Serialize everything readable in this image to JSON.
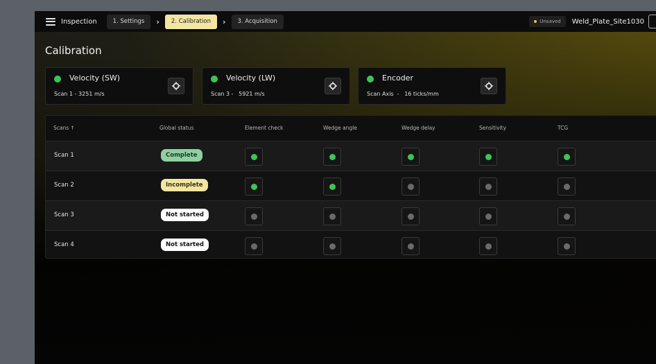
{
  "header": {
    "app_name": "Inspection",
    "steps": [
      {
        "label": "1. Settings"
      },
      {
        "label": "2. Calibration"
      },
      {
        "label": "3. Acquisition"
      }
    ],
    "unsaved_label": "Unsaved",
    "project_name": "Weld_Plate_Site1030"
  },
  "page_title": "Calibration",
  "cards": [
    {
      "title": "Velocity (SW)",
      "detail": "Scan 1 - 3251 m/s",
      "status": "ok"
    },
    {
      "title": "Velocity (LW)",
      "detail": "Scan 3 -   5921 m/s",
      "status": "ok"
    },
    {
      "title": "Encoder",
      "detail": "Scan Axis  -   16 ticks/mm",
      "status": "ok"
    }
  ],
  "table": {
    "columns": [
      "Scans",
      "Global status",
      "Element check",
      "Wedge angle",
      "Wedge delay",
      "Sensitivity",
      "TCG"
    ],
    "sort_indicator": "↑",
    "rows": [
      {
        "scan": "Scan 1",
        "status": "Complete",
        "checks": [
          true,
          true,
          true,
          true,
          true
        ]
      },
      {
        "scan": "Scan 2",
        "status": "Incomplete",
        "checks": [
          true,
          true,
          false,
          false,
          false
        ]
      },
      {
        "scan": "Scan 3",
        "status": "Not started",
        "checks": [
          false,
          false,
          false,
          false,
          false
        ]
      },
      {
        "scan": "Scan 4",
        "status": "Not started",
        "checks": [
          false,
          false,
          false,
          false,
          false
        ]
      }
    ]
  },
  "colors": {
    "accent": "#f3e6a2",
    "ok_led": "#3ec454",
    "off_led": "#6a6a6a",
    "complete_bg": "#8fd0a0",
    "incomplete_bg": "#f3e6a2",
    "not_started_bg": "#ffffff"
  }
}
